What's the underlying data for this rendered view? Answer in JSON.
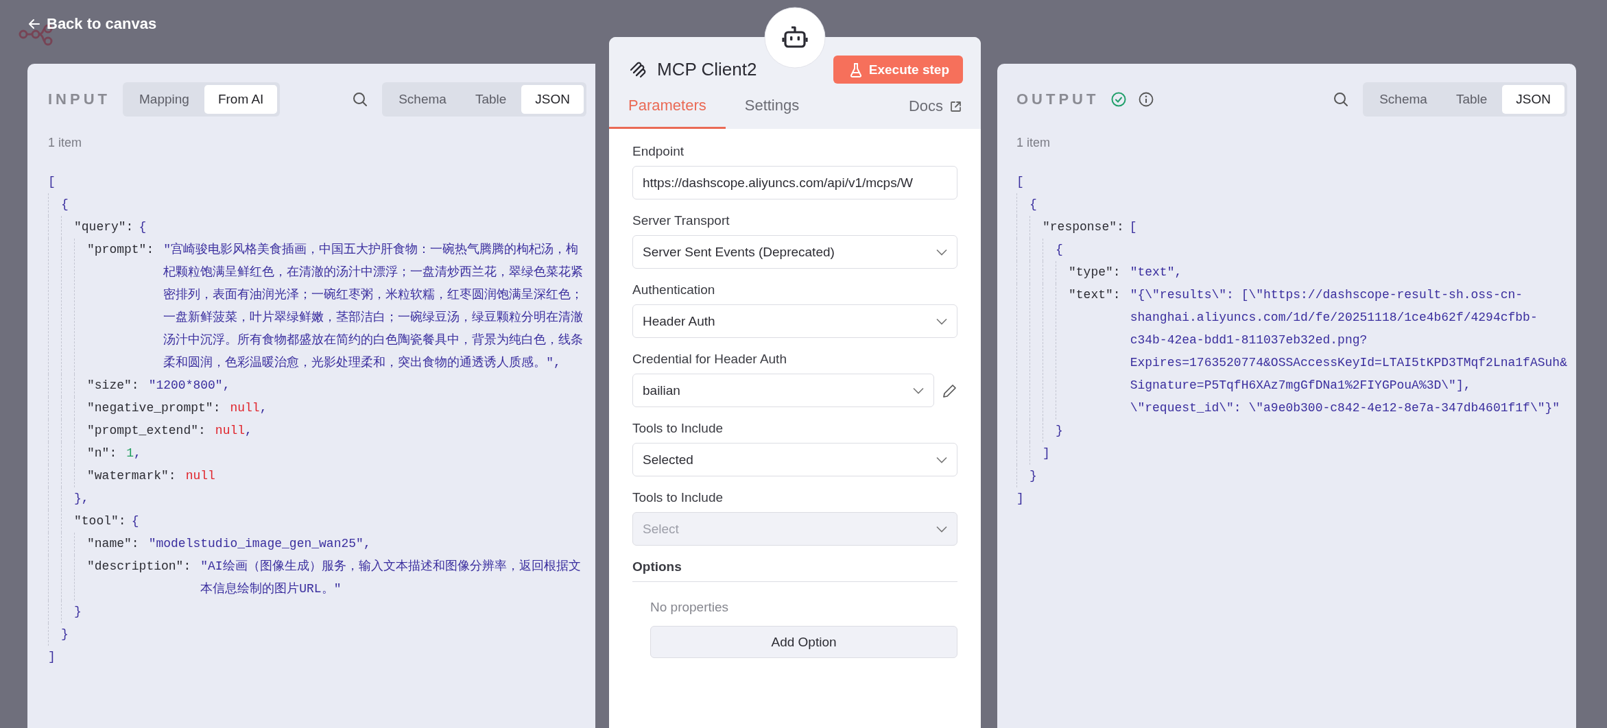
{
  "back_link": {
    "label": "Back to canvas"
  },
  "input": {
    "title": "INPUT",
    "modes": [
      {
        "label": "Mapping",
        "selected": false
      },
      {
        "label": "From AI",
        "selected": true
      }
    ],
    "views": [
      {
        "label": "Schema",
        "selected": false
      },
      {
        "label": "Table",
        "selected": false
      },
      {
        "label": "JSON",
        "selected": true
      }
    ],
    "count": "1 item",
    "json": {
      "open": "[",
      "close": "]",
      "children": [
        {
          "open": "{",
          "close": "}",
          "children": [
            {
              "key": "\"query\":",
              "open": "{",
              "close": "},",
              "children": [
                {
                  "key": "\"prompt\":",
                  "kind": "string",
                  "value": "\"宫崎骏电影风格美食插画，中国五大护肝食物：一碗热气腾腾的枸杞汤，枸杞颗粒饱满呈鲜红色，在清澈的汤汁中漂浮；一盘清炒西兰花，翠绿色菜花紧密排列，表面有油润光泽；一碗红枣粥，米粒软糯，红枣圆润饱满呈深红色；一盘新鲜菠菜，叶片翠绿鲜嫩，茎部洁白；一碗绿豆汤，绿豆颗粒分明在清澈汤汁中沉浮。所有食物都盛放在简约的白色陶瓷餐具中，背景为纯白色，线条柔和圆润，色彩温暖治愈，光影处理柔和，突出食物的通透诱人质感。\","
                },
                {
                  "key": "\"size\":",
                  "kind": "string",
                  "value": "\"1200*800\","
                },
                {
                  "key": "\"negative_prompt\":",
                  "kind": "null",
                  "value": "null",
                  "suffix": ","
                },
                {
                  "key": "\"prompt_extend\":",
                  "kind": "null",
                  "value": "null",
                  "suffix": ","
                },
                {
                  "key": "\"n\":",
                  "kind": "number",
                  "value": "1",
                  "suffix": ","
                },
                {
                  "key": "\"watermark\":",
                  "kind": "null",
                  "value": "null"
                }
              ]
            },
            {
              "key": "\"tool\":",
              "open": "{",
              "close": "}",
              "children": [
                {
                  "key": "\"name\":",
                  "kind": "string",
                  "value": "\"modelstudio_image_gen_wan25\","
                },
                {
                  "key": "\"description\":",
                  "kind": "string",
                  "value": "\"AI绘画（图像生成）服务，输入文本描述和图像分辨率，返回根据文本信息绘制的图片URL。\""
                }
              ]
            }
          ]
        }
      ]
    }
  },
  "node": {
    "title": "MCP Client2",
    "execute_button": "Execute step",
    "tabs": [
      {
        "label": "Parameters",
        "selected": true
      },
      {
        "label": "Settings",
        "selected": false
      }
    ],
    "docs_link": "Docs",
    "fields": [
      {
        "label": "Endpoint",
        "kind": "input",
        "value": "https://dashscope.aliyuncs.com/api/v1/mcps/W",
        "disabled": false,
        "editable": false
      },
      {
        "label": "Server Transport",
        "kind": "select",
        "value": "Server Sent Events (Deprecated)",
        "disabled": false,
        "editable": false
      },
      {
        "label": "Authentication",
        "kind": "select",
        "value": "Header Auth",
        "disabled": false,
        "editable": false
      },
      {
        "label": "Credential for Header Auth",
        "kind": "select",
        "value": "bailian",
        "disabled": false,
        "editable": true
      },
      {
        "label": "Tools to Include",
        "kind": "select",
        "value": "Selected",
        "disabled": false,
        "editable": false
      },
      {
        "label": "Tools to Include",
        "kind": "select",
        "placeholder": "Select",
        "disabled": true,
        "editable": false
      }
    ],
    "options": {
      "title": "Options",
      "empty_text": "No properties",
      "add_button": "Add Option"
    }
  },
  "output": {
    "title": "OUTPUT",
    "succeeded": true,
    "views": [
      {
        "label": "Schema",
        "selected": false
      },
      {
        "label": "Table",
        "selected": false
      },
      {
        "label": "JSON",
        "selected": true
      }
    ],
    "count": "1 item",
    "json": {
      "open": "[",
      "close": "]",
      "children": [
        {
          "open": "{",
          "close": "}",
          "children": [
            {
              "key": "\"response\":",
              "open": "[",
              "close": "]",
              "children": [
                {
                  "open": "{",
                  "close": "}",
                  "children": [
                    {
                      "key": "\"type\":",
                      "kind": "string",
                      "value": "\"text\","
                    },
                    {
                      "key": "\"text\":",
                      "kind": "string",
                      "value": "\"{\\\"results\\\": [\\\"https://dashscope-result-sh.oss-cn-shanghai.aliyuncs.com/1d/fe/20251118/1ce4b62f/4294cfbb-c34b-42ea-bdd1-811037eb32ed.png?Expires=1763520774&OSSAccessKeyId=LTAI5tKPD3TMqf2Lna1fASuh&Signature=P5TqfH6XAz7mgGfDNa1%2FIYGPouA%3D\\\"], \\\"request_id\\\": \\\"a9e0b300-c842-4e12-8e7a-347db4601f1f\\\"}\""
                    }
                  ]
                }
              ]
            }
          ]
        }
      ]
    }
  }
}
